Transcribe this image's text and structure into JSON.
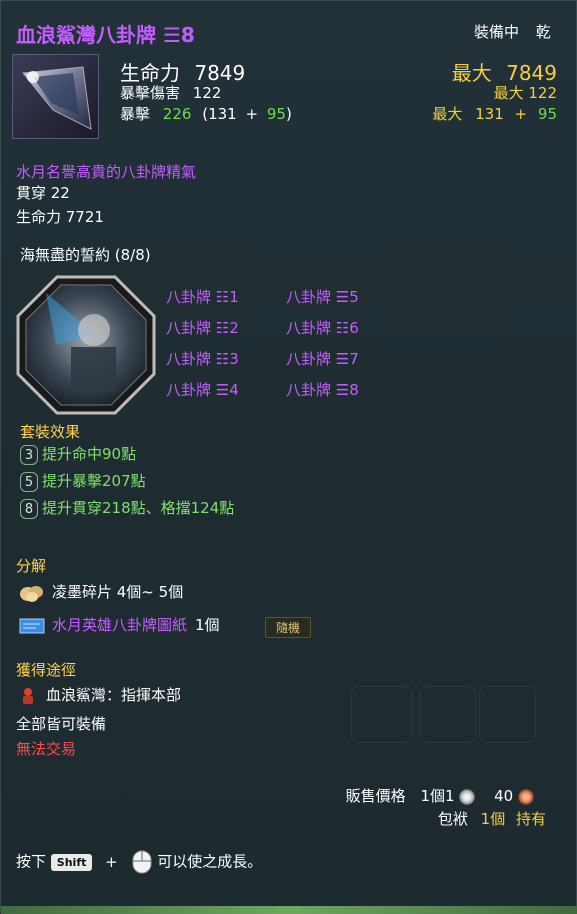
{
  "header": {
    "item_name": "血浪鯊灣八卦牌",
    "item_number": "☰8",
    "status": "裝備中",
    "position": "乾"
  },
  "stats": {
    "hp_label": "生命力",
    "hp_value": "7849",
    "crit_dmg_label": "暴擊傷害",
    "crit_dmg_value": "122",
    "crit_label": "暴擊",
    "crit_value": "226",
    "crit_paren_open": "(131",
    "crit_plus": "+",
    "crit_bonus": "95",
    "crit_paren_close": ")",
    "max_hp_label": "最大",
    "max_hp_value": "7849",
    "max_crit_dmg": "最大  122",
    "max_crit_label": "最大",
    "max_crit_base": "131",
    "max_crit_plus": "+",
    "max_crit_bonus": "95"
  },
  "essence": {
    "title": "水月名譽高貴的八卦牌精氣",
    "pierce": "貫穿  22",
    "hp": "生命力  7721"
  },
  "set": {
    "name": "海無盡的誓約 (8/8)",
    "pieces": [
      "八卦牌 ☷1",
      "八卦牌 ☰5",
      "八卦牌 ☷2",
      "八卦牌 ☷6",
      "八卦牌 ☷3",
      "八卦牌 ☰7",
      "八卦牌 ☰4",
      "八卦牌 ☰8"
    ],
    "effects_title": "套裝效果",
    "effects": [
      {
        "num": "3",
        "text": "提升命中90點"
      },
      {
        "num": "5",
        "text": "提升暴擊207點"
      },
      {
        "num": "8",
        "text": "提升貫穿218點、格擋124點"
      }
    ]
  },
  "decompose": {
    "title": "分解",
    "item1": "凌墨碎片  4個~  5個",
    "item2_name": "水月英雄八卦牌圖紙",
    "item2_qty": "1個",
    "item2_tag": "隨機"
  },
  "acquire": {
    "title": "獲得途徑",
    "source": "血浪鯊灣：指揮本部",
    "equip": "全部皆可裝備",
    "trade": "無法交易"
  },
  "footer": {
    "sell_label": "販售價格",
    "sell_qty": "1個1",
    "sell_amount": "40",
    "bag_label": "包袱",
    "bag_qty": "1個",
    "bag_own": "持有",
    "hint_prefix": "按下",
    "shift": "Shift",
    "plus": "+",
    "hint_suffix": "可以使之成長。"
  },
  "colors": {
    "purple": "#c45dff",
    "gold": "#f4d03f",
    "green": "#69e04a",
    "red": "#ff4b4b"
  }
}
